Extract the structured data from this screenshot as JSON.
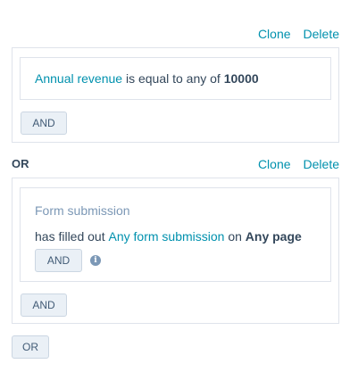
{
  "group1": {
    "clone_label": "Clone",
    "delete_label": "Delete",
    "filter": {
      "property": "Annual revenue",
      "operator": " is equal to any of ",
      "value": "10000"
    },
    "and_label": "AND"
  },
  "or_separator": "OR",
  "group2": {
    "clone_label": "Clone",
    "delete_label": "Delete",
    "filter": {
      "category": "Form submission",
      "prefix": "has filled out ",
      "form": "Any form submission",
      "connector": " on ",
      "page": "Any page",
      "and_label": "AND",
      "info_icon": "i"
    },
    "and_label": "AND"
  },
  "or_button_label": "OR"
}
